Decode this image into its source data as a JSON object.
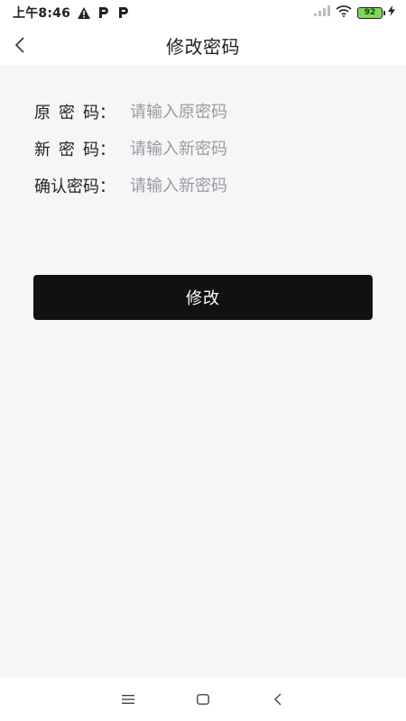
{
  "status_bar": {
    "time": "上午8:46",
    "battery_level": "92",
    "icons": [
      "warning-icon",
      "parking-icon",
      "parking-icon",
      "signal-icon",
      "wifi-icon",
      "battery-icon",
      "charging-icon"
    ]
  },
  "header": {
    "title": "修改密码",
    "back_icon": "chevron-left-icon"
  },
  "form": {
    "fields": [
      {
        "label_chars": [
          "原",
          "密",
          "码："
        ],
        "placeholder": "请输入原密码"
      },
      {
        "label_chars": [
          "新",
          "密",
          "码："
        ],
        "placeholder": "请输入新密码"
      },
      {
        "label_chars": [
          "确认密码："
        ],
        "placeholder": "请输入新密码"
      }
    ]
  },
  "submit": {
    "label": "修改"
  },
  "colors": {
    "accent": "#111114",
    "background": "#f6f6f9",
    "placeholder": "#9a9a9e"
  },
  "nav_bar": {
    "icons": [
      "menu-icon",
      "home-icon",
      "back-icon"
    ]
  }
}
